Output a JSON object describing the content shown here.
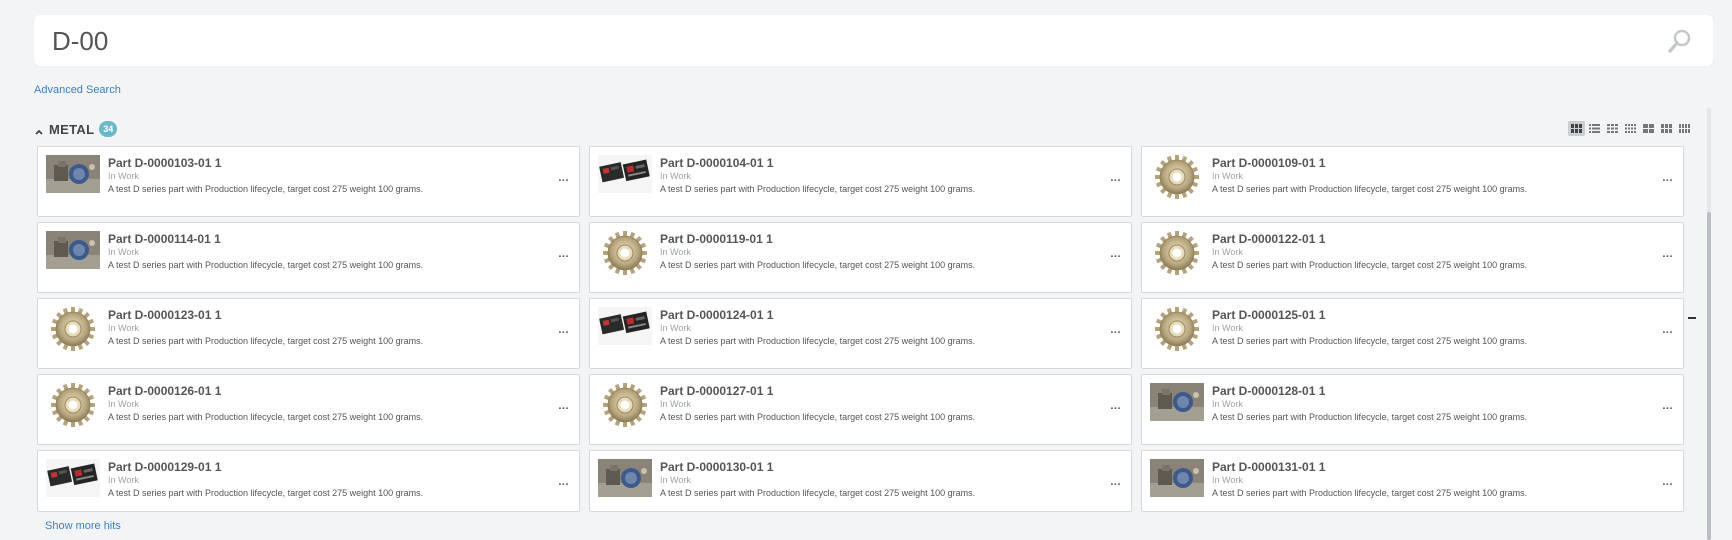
{
  "search": {
    "value": "D-00",
    "icon": "search-icon"
  },
  "advanced_search_label": "Advanced Search",
  "section": {
    "title": "METAL",
    "count": "34",
    "badge_color": "#6bb8c8",
    "view_modes": [
      "grid-view-icon",
      "list-view-icon",
      "table-view-icon",
      "grid-3-view-icon",
      "grid-4-view-icon",
      "grid-5-view-icon",
      "grid-6-view-icon"
    ]
  },
  "cards": [
    {
      "title": "Part D-0000103-01 1",
      "status": "In Work",
      "description": "A test D series part with Production lifecycle, target cost 275 weight 100 grams.",
      "thumbnail": "engine-photo"
    },
    {
      "title": "Part D-0000104-01 1",
      "status": "In Work",
      "description": "A test D series part with Production lifecycle, target cost 275 weight 100 grams.",
      "thumbnail": "circuit-board"
    },
    {
      "title": "Part D-0000109-01 1",
      "status": "In Work",
      "description": "A test D series part with Production lifecycle, target cost 275 weight 100 grams.",
      "thumbnail": "gear"
    },
    {
      "title": "Part D-0000114-01 1",
      "status": "In Work",
      "description": "A test D series part with Production lifecycle, target cost 275 weight 100 grams.",
      "thumbnail": "engine-photo"
    },
    {
      "title": "Part D-0000119-01 1",
      "status": "In Work",
      "description": "A test D series part with Production lifecycle, target cost 275 weight 100 grams.",
      "thumbnail": "gear"
    },
    {
      "title": "Part D-0000122-01 1",
      "status": "In Work",
      "description": "A test D series part with Production lifecycle, target cost 275 weight 100 grams.",
      "thumbnail": "gear"
    },
    {
      "title": "Part D-0000123-01 1",
      "status": "In Work",
      "description": "A test D series part with Production lifecycle, target cost 275 weight 100 grams.",
      "thumbnail": "gear"
    },
    {
      "title": "Part D-0000124-01 1",
      "status": "In Work",
      "description": "A test D series part with Production lifecycle, target cost 275 weight 100 grams.",
      "thumbnail": "circuit-board"
    },
    {
      "title": "Part D-0000125-01 1",
      "status": "In Work",
      "description": "A test D series part with Production lifecycle, target cost 275 weight 100 grams.",
      "thumbnail": "gear"
    },
    {
      "title": "Part D-0000126-01 1",
      "status": "In Work",
      "description": "A test D series part with Production lifecycle, target cost 275 weight 100 grams.",
      "thumbnail": "gear"
    },
    {
      "title": "Part D-0000127-01 1",
      "status": "In Work",
      "description": "A test D series part with Production lifecycle, target cost 275 weight 100 grams.",
      "thumbnail": "gear"
    },
    {
      "title": "Part D-0000128-01 1",
      "status": "In Work",
      "description": "A test D series part with Production lifecycle, target cost 275 weight 100 grams.",
      "thumbnail": "engine-photo"
    },
    {
      "title": "Part D-0000129-01 1",
      "status": "In Work",
      "description": "A test D series part with Production lifecycle, target cost 275 weight 100 grams.",
      "thumbnail": "circuit-board"
    },
    {
      "title": "Part D-0000130-01 1",
      "status": "In Work",
      "description": "A test D series part with Production lifecycle, target cost 275 weight 100 grams.",
      "thumbnail": "engine-photo"
    },
    {
      "title": "Part D-0000131-01 1",
      "status": "In Work",
      "description": "A test D series part with Production lifecycle, target cost 275 weight 100 grams.",
      "thumbnail": "engine-photo"
    }
  ],
  "card_menu_label": "...",
  "show_more_label": "Show more hits"
}
